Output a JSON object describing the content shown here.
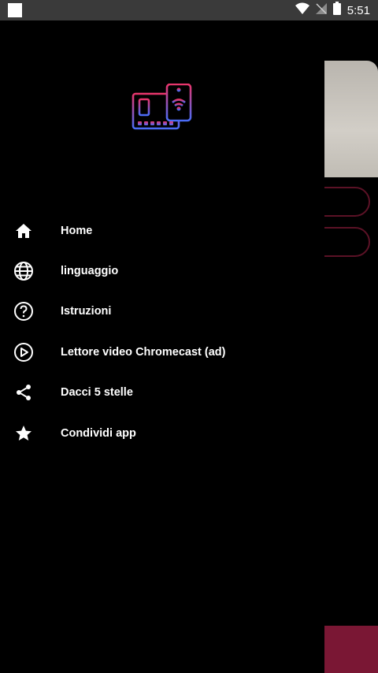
{
  "status_bar": {
    "time": "5:51"
  },
  "drawer": {
    "logo_icon": "screen-mirroring-logo-icon",
    "menu_items": [
      {
        "label": "Home",
        "icon": "home-icon"
      },
      {
        "label": "linguaggio",
        "icon": "globe-icon"
      },
      {
        "label": "Istruzioni",
        "icon": "help-circle-icon"
      },
      {
        "label": "Lettore video Chromecast (ad)",
        "icon": "play-circle-icon"
      },
      {
        "label": "Dacci 5 stelle",
        "icon": "share-icon"
      },
      {
        "label": "Condividi app",
        "icon": "star-icon"
      }
    ]
  },
  "colors": {
    "background": "#000000",
    "status_bar": "#3a3a3a",
    "text": "#ffffff",
    "accent": "#7a1734",
    "logo_gradient_start": "#e8356b",
    "logo_gradient_end": "#4a6cf7"
  }
}
